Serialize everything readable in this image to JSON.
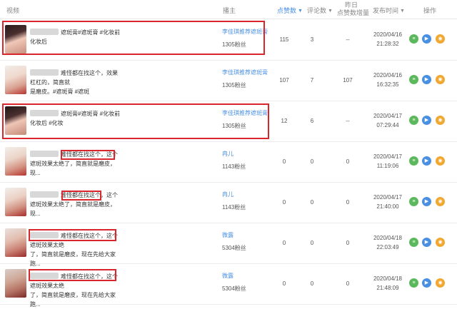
{
  "header": {
    "video": "视频",
    "author": "播主",
    "likes": "点赞数",
    "comments": "评论数",
    "yesterday_likes_line1": "昨日",
    "yesterday_likes_line2": "点赞数增量",
    "publish_time": "发布时间",
    "operations": "操作",
    "sort_caret": "▼"
  },
  "rows": [
    {
      "title_line1": "遮斑膏#遮斑膏 #化妆前",
      "title_line2": "化妆后",
      "author": "李佳琪推荐遮斑膏",
      "fans": "1305粉丝",
      "likes": "115",
      "comments": "3",
      "yesterday": "--",
      "date": "2020/04/16",
      "time": "21:28:32"
    },
    {
      "title_line1": "难怪都在找这个，效果杠杠的，简直就",
      "title_line2": "是磨皮。#遮斑膏 #遮斑",
      "author": "李佳琪推荐遮斑膏",
      "fans": "1305粉丝",
      "likes": "107",
      "comments": "7",
      "yesterday": "107",
      "date": "2020/04/16",
      "time": "16:32:35"
    },
    {
      "title_line1": "遮斑膏#遮斑膏 #化妆前",
      "title_line2": "化妆后 #化妆",
      "author": "李佳琪推荐遮斑膏",
      "fans": "1305粉丝",
      "likes": "12",
      "comments": "6",
      "yesterday": "--",
      "date": "2020/04/17",
      "time": "07:29:44"
    },
    {
      "title_line1": "难怪都在找这个，这个",
      "title_line2": "遮斑效果太绝了，简直就是磨皮，现...",
      "author": "冉儿",
      "fans": "1143粉丝",
      "likes": "0",
      "comments": "0",
      "yesterday": "0",
      "date": "2020/04/17",
      "time": "11:19:06"
    },
    {
      "title_line1": "难怪都在找这个，这个",
      "title_line2": "遮斑效果太绝了，简直就是磨皮，现...",
      "author": "冉儿",
      "fans": "1143粉丝",
      "likes": "0",
      "comments": "0",
      "yesterday": "0",
      "date": "2020/04/17",
      "time": "21:40:00"
    },
    {
      "title_line1": "难怪都在找这个，这个遮斑效果太绝",
      "title_line2": "了，简直就是磨皮，现在先给大家跑...",
      "author": "微露",
      "fans": "5304粉丝",
      "likes": "0",
      "comments": "0",
      "yesterday": "0",
      "date": "2020/04/18",
      "time": "22:03:49"
    },
    {
      "title_line1": "难怪都在找这个，这个遮斑效果太绝",
      "title_line2": "了，简直就是磨皮，现在先给大家跑...",
      "author": "微露",
      "fans": "5304粉丝",
      "likes": "0",
      "comments": "0",
      "yesterday": "0",
      "date": "2020/04/18",
      "time": "21:48:09"
    }
  ],
  "ops": {
    "detail_icon": "≡",
    "play_icon": "▶",
    "analyze_icon": "◉"
  },
  "colors": {
    "accent": "#4a90e2",
    "highlight": "#d9262c",
    "green": "#5cb85c",
    "orange": "#f0a830"
  }
}
